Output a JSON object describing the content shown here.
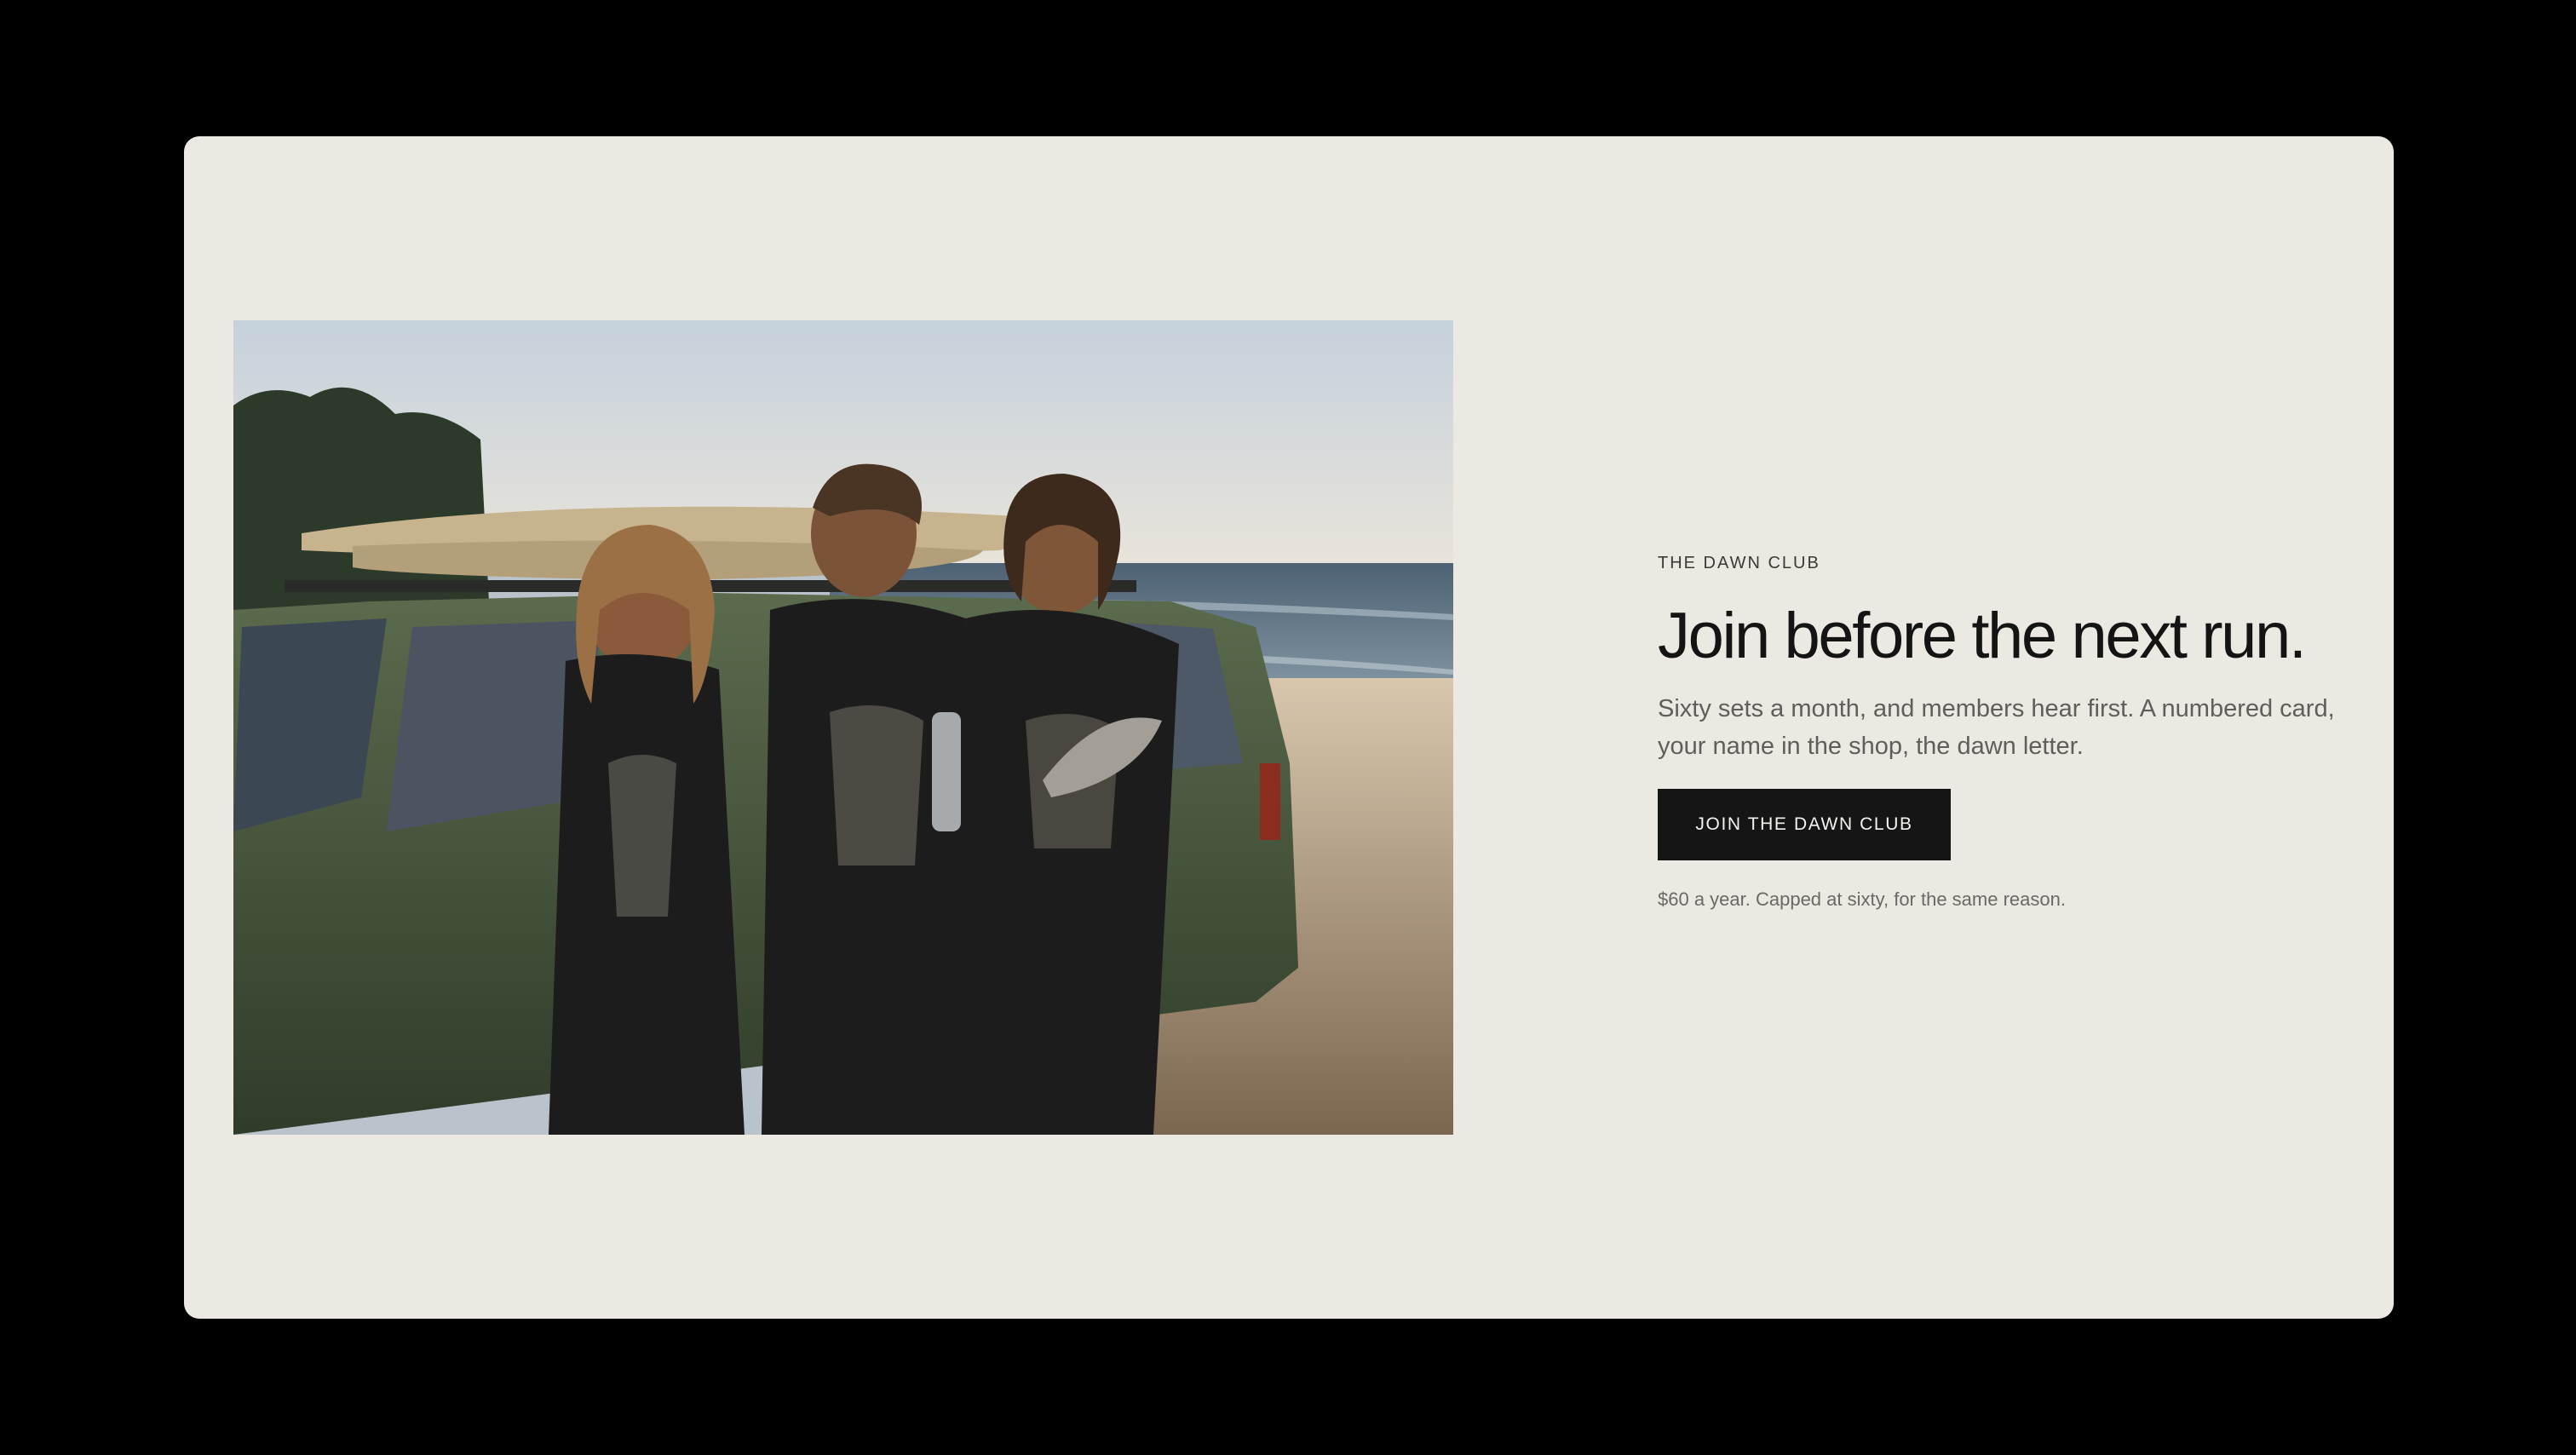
{
  "promo": {
    "eyebrow": "THE DAWN CLUB",
    "headline": "Join before the next run.",
    "body": "Sixty sets a month, and members hear first. A numbered card, your name in the shop, the dawn letter.",
    "cta_label": "JOIN THE DAWN CLUB",
    "fine_print": "$60 a year. Capped at sixty, for the same reason."
  },
  "colors": {
    "page_background": "#000000",
    "card_background": "#ece9e3",
    "cta_background": "#151515",
    "cta_text": "#f5f3ef",
    "headline": "#141414"
  }
}
